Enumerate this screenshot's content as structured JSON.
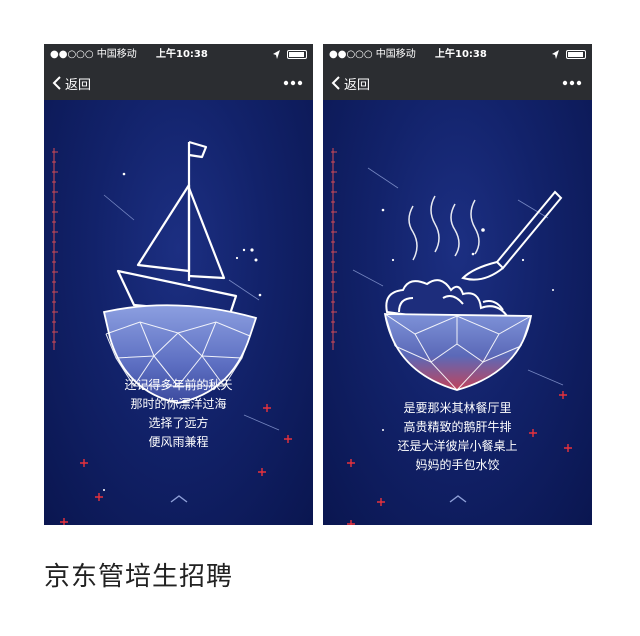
{
  "phones": [
    {
      "status": {
        "carrier": "●●○○○ 中国移动",
        "time": "上午10:38"
      },
      "nav": {
        "back_label": "返回"
      },
      "caption_lines": [
        "还记得多年前的秋天",
        "那时的你漂洋过海",
        "选择了远方",
        "便风雨兼程"
      ]
    },
    {
      "status": {
        "carrier": "●●○○○ 中国移动",
        "time": "上午10:38"
      },
      "nav": {
        "back_label": "返回"
      },
      "caption_lines": [
        "是要那米其林餐厅里",
        "高贵精致的鹅肝牛排",
        "还是大洋彼岸小餐桌上",
        "妈妈的手包水饺"
      ]
    }
  ],
  "footer": {
    "title": "京东管培生招聘"
  },
  "colors": {
    "bg_deep": "#0b1850",
    "chrome": "#2b2d31",
    "accent_red": "#e8323c"
  },
  "icons": [
    "wifi-icon",
    "location-arrow-icon",
    "battery-icon",
    "back-chevron-icon",
    "more-icon",
    "boat-icon",
    "bowl-icon",
    "dumplings-icon",
    "spoon-icon",
    "swipe-up-icon"
  ]
}
